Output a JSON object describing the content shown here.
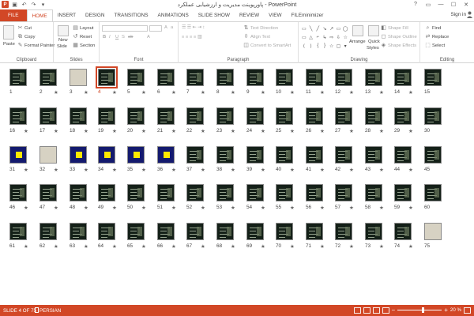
{
  "window": {
    "title": "پاورپوینت مدیریت و ارزشیابی عملکرد - PowerPoint",
    "signin": "Sign in"
  },
  "tabs": [
    "FILE",
    "HOME",
    "INSERT",
    "DESIGN",
    "TRANSITIONS",
    "ANIMATIONS",
    "SLIDE SHOW",
    "REVIEW",
    "VIEW",
    "FILEminimizer"
  ],
  "active_tab": "HOME",
  "ribbon": {
    "clipboard": {
      "label": "Clipboard",
      "paste": "Paste",
      "cut": "Cut",
      "copy": "Copy",
      "format_painter": "Format Painter"
    },
    "slides": {
      "label": "Slides",
      "new_slide": "New",
      "new_slide2": "Slide",
      "layout": "Layout",
      "reset": "Reset",
      "section": "Section"
    },
    "font": {
      "label": "Font"
    },
    "paragraph": {
      "label": "Paragraph",
      "text_direction": "Text Direction",
      "align_text": "Align Text",
      "convert_smartart": "Convert to SmartArt"
    },
    "drawing": {
      "label": "Drawing",
      "arrange": "Arrange",
      "quick_styles": "Quick",
      "quick_styles2": "Styles",
      "shape_fill": "Shape Fill",
      "shape_outline": "Shape Outline",
      "shape_effects": "Shape Effects"
    },
    "editing": {
      "label": "Editing",
      "find": "Find",
      "replace": "Replace",
      "select": "Select"
    }
  },
  "slides": {
    "total": 75,
    "selected": 4,
    "blue_slides": [
      31,
      33,
      34,
      35,
      36
    ],
    "light_slides": [
      3,
      32,
      75
    ],
    "numbers": [
      "1",
      "2",
      "3",
      "4",
      "5",
      "6",
      "7",
      "8",
      "9",
      "10",
      "11",
      "12",
      "13",
      "14",
      "15",
      "16",
      "17",
      "18",
      "19",
      "20",
      "21",
      "22",
      "23",
      "24",
      "25",
      "26",
      "27",
      "28",
      "29",
      "30",
      "31",
      "32",
      "33",
      "34",
      "35",
      "36",
      "37",
      "38",
      "39",
      "40",
      "41",
      "42",
      "43",
      "44",
      "45",
      "46",
      "47",
      "48",
      "49",
      "50",
      "51",
      "52",
      "53",
      "54",
      "55",
      "56",
      "57",
      "58",
      "59",
      "60",
      "61",
      "62",
      "63",
      "64",
      "65",
      "66",
      "67",
      "68",
      "69",
      "70",
      "71",
      "72",
      "73",
      "74",
      "75"
    ],
    "star_symbol": "★"
  },
  "status": {
    "slide_info": "SLIDE 4 OF 75",
    "language": "PERSIAN",
    "zoom": "20 %",
    "zoom_level": 0.2
  },
  "colors": {
    "accent": "#d24726",
    "slide_dark": "#142018",
    "slide_blue": "#141a6e"
  },
  "icons": [
    "powerpoint-logo",
    "save-icon",
    "undo-icon",
    "redo-icon",
    "help-icon",
    "minimize-icon",
    "maximize-icon",
    "close-icon",
    "paste-icon",
    "cut-icon",
    "copy-icon",
    "format-painter-icon",
    "new-slide-icon",
    "find-icon",
    "replace-icon",
    "select-icon"
  ]
}
